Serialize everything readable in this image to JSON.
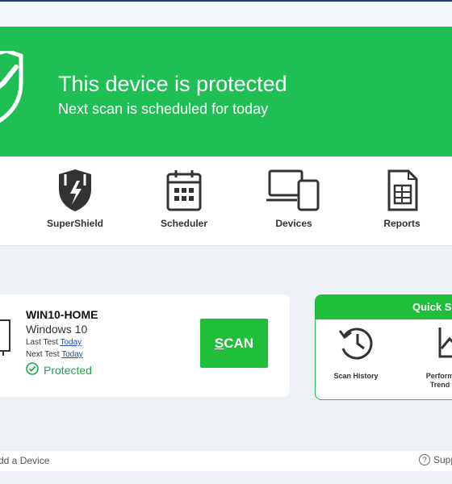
{
  "hero": {
    "title": "This device is protected",
    "subtitle": "Next scan is scheduled for today"
  },
  "features": [
    {
      "label": "SuperShield",
      "icon": "supershield-icon"
    },
    {
      "label": "Scheduler",
      "icon": "calendar-icon"
    },
    {
      "label": "Devices",
      "icon": "devices-icon"
    },
    {
      "label": "Reports",
      "icon": "report-icon"
    }
  ],
  "device": {
    "name": "WIN10-HOME",
    "os": "Windows 10",
    "last_test_label": "Last Test",
    "last_test_value": "Today",
    "next_test_label": "Next Test",
    "next_test_value": "Today",
    "status": "Protected"
  },
  "scan_button": {
    "label_first": "S",
    "label_rest": "CAN"
  },
  "quick": {
    "title": "Quick S",
    "items": [
      {
        "label": "Scan History",
        "icon": "history-icon"
      },
      {
        "label": "Perform\nTrend",
        "icon": "trend-icon"
      }
    ]
  },
  "footer": {
    "add_device": "dd a Device",
    "support": "Supp"
  },
  "colors": {
    "accent": "#1fbf56",
    "button": "#1fbf3a",
    "link": "#1a4fb5"
  }
}
